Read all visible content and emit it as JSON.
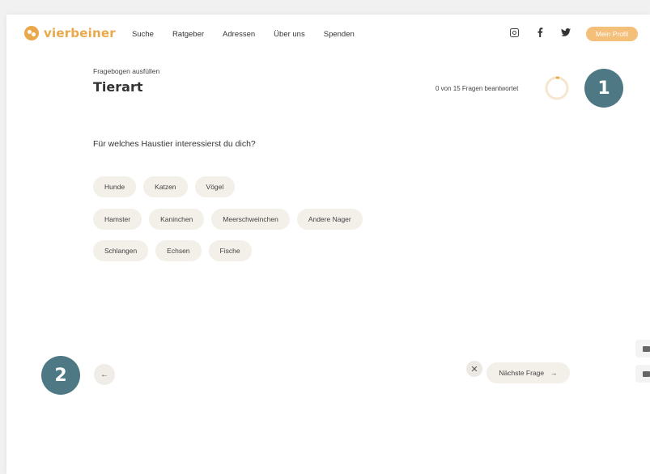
{
  "brand": {
    "name": "vierbeiner",
    "accent": "#e9a94b",
    "icon": "paw-icon"
  },
  "nav": {
    "items": [
      "Suche",
      "Ratgeber",
      "Adressen",
      "Über uns",
      "Spenden"
    ]
  },
  "social": {
    "icons": [
      "instagram-icon",
      "facebook-icon",
      "twitter-icon"
    ]
  },
  "profile": {
    "label": "Mein Profil",
    "color": "#f3bf79"
  },
  "section": {
    "subtitle": "Fragebogen ausfüllen",
    "title": "Tierart"
  },
  "progress": {
    "text": "0 von 15 Fragen beantwortet",
    "answered": 0,
    "total": 15,
    "fraction": 0.0
  },
  "question": {
    "text": "Für welches Haustier interessierst du dich?"
  },
  "options": {
    "row1": [
      "Hunde",
      "Katzen",
      "Vögel"
    ],
    "row2": [
      "Hamster",
      "Kaninchen",
      "Meerschweinchen",
      "Andere Nager"
    ],
    "row3": [
      "Schlangen",
      "Echsen",
      "Fische"
    ]
  },
  "navigation": {
    "back_icon": "←",
    "skip_icon": "✕",
    "next_label": "Nächste Frage",
    "next_icon": "→"
  },
  "badges": {
    "one": "1",
    "two": "2",
    "color": "#4f7885"
  }
}
